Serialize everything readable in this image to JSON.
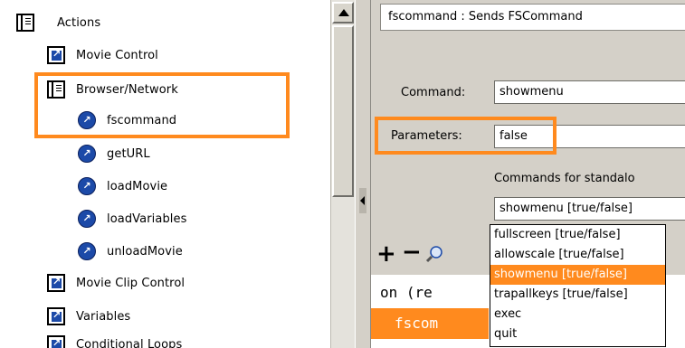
{
  "actions_panel": {
    "items": [
      {
        "label": "Actions",
        "icon": "book-icon"
      },
      {
        "label": "Movie Control",
        "icon": "folder-icon"
      },
      {
        "label": "Browser/Network",
        "icon": "book-icon"
      },
      {
        "label": "fscommand",
        "icon": "action-icon"
      },
      {
        "label": "getURL",
        "icon": "action-icon"
      },
      {
        "label": "loadMovie",
        "icon": "action-icon"
      },
      {
        "label": "loadVariables",
        "icon": "action-icon"
      },
      {
        "label": "unloadMovie",
        "icon": "action-icon"
      },
      {
        "label": "Movie Clip Control",
        "icon": "folder-icon"
      },
      {
        "label": "Variables",
        "icon": "folder-icon"
      },
      {
        "label": "Conditional Loops",
        "icon": "folder-icon"
      }
    ]
  },
  "parameters_panel": {
    "description": "fscommand : Sends FSCommand",
    "command_label": "Command:",
    "command_value": "showmenu",
    "parameters_label": "Parameters:",
    "parameters_value": "false",
    "hint": "Commands for standalo",
    "combo_selected": "showmenu [true/false]",
    "dropdown_options": [
      "fullscreen [true/false]",
      "allowscale [true/false]",
      "showmenu [true/false]",
      "trapallkeys [true/false]",
      "exec",
      "quit"
    ],
    "selected_option_index": 2,
    "toolbar": {
      "add_label": "+",
      "remove_label": "−"
    },
    "code_lines": [
      "on (re",
      "fscom"
    ]
  },
  "colors": {
    "highlight": "#ff8a1e",
    "panel_bg": "#d4d0c8",
    "icon_blue": "#1c4aa8"
  }
}
